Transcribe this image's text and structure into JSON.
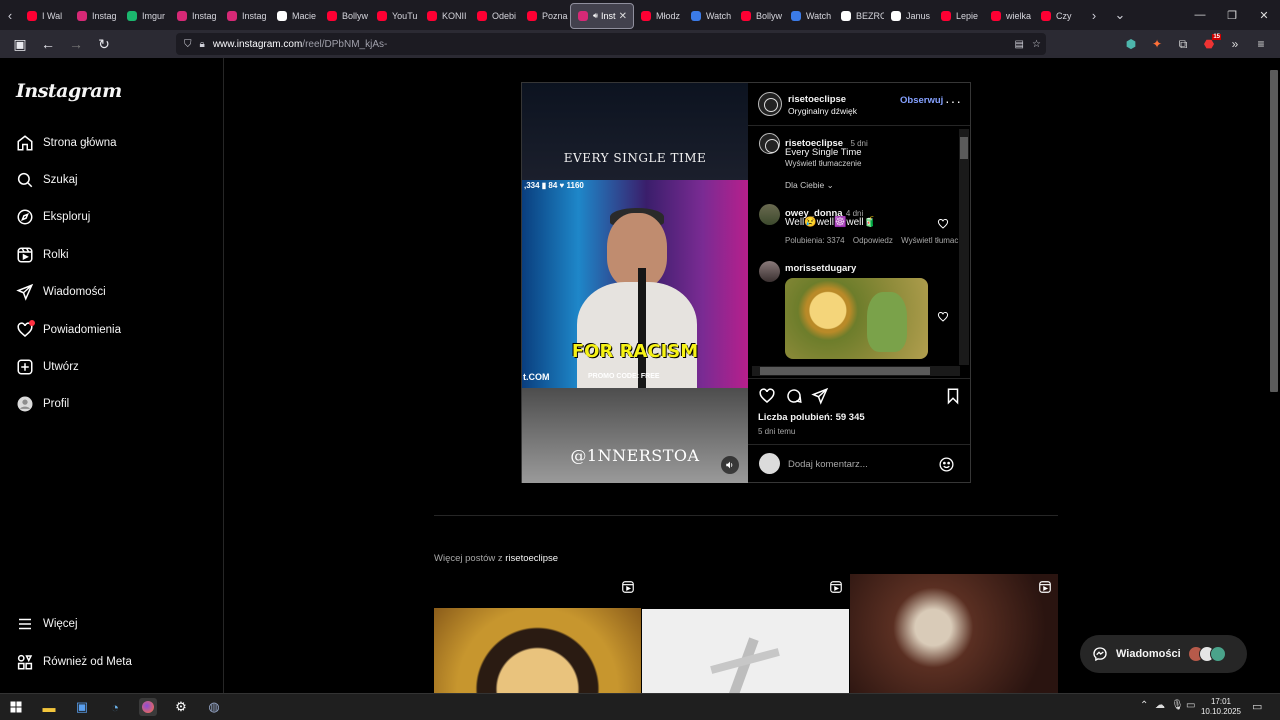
{
  "browser": {
    "tabs": [
      {
        "label": "I Wal",
        "color": "#ff0033"
      },
      {
        "label": "Instag",
        "color": "#d62976"
      },
      {
        "label": "Imgur",
        "color": "#1bb76e"
      },
      {
        "label": "Instag",
        "color": "#d62976"
      },
      {
        "label": "Instag",
        "color": "#d62976"
      },
      {
        "label": "Macie",
        "color": "#ffffff"
      },
      {
        "label": "Bollyw",
        "color": "#ff0033"
      },
      {
        "label": "YouTu",
        "color": "#ff0033"
      },
      {
        "label": "KONII",
        "color": "#ff0033"
      },
      {
        "label": "Odebi",
        "color": "#ff0033"
      },
      {
        "label": "Pozna",
        "color": "#ff0033"
      },
      {
        "label": "Inst",
        "color": "#d62976",
        "active": true
      },
      {
        "label": "Młodz",
        "color": "#ff0033"
      },
      {
        "label": "Watch",
        "color": "#3b7be8"
      },
      {
        "label": "Bollyw",
        "color": "#ff0033"
      },
      {
        "label": "Watch",
        "color": "#3b7be8"
      },
      {
        "label": "BEZRO",
        "color": "#ffffff"
      },
      {
        "label": "Janus",
        "color": "#ffffff"
      },
      {
        "label": "Lepie",
        "color": "#ff0033"
      },
      {
        "label": "wielka",
        "color": "#ff0033"
      },
      {
        "label": "Czy",
        "color": "#ff0033"
      }
    ],
    "url_host": "www.instagram.com",
    "url_path": "/reel/DPbNM_kjAs-",
    "extension_badge": "15"
  },
  "sidebar": {
    "logo": "Instagram",
    "items": [
      {
        "label": "Strona główna",
        "icon": "home-icon"
      },
      {
        "label": "Szukaj",
        "icon": "search-icon"
      },
      {
        "label": "Eksploruj",
        "icon": "explore-icon"
      },
      {
        "label": "Rolki",
        "icon": "reels-icon"
      },
      {
        "label": "Wiadomości",
        "icon": "messages-icon"
      },
      {
        "label": "Powiadomienia",
        "icon": "heart-icon"
      },
      {
        "label": "Utwórz",
        "icon": "create-icon"
      },
      {
        "label": "Profil",
        "icon": "profile-avatar-icon"
      }
    ],
    "bottom": [
      {
        "label": "Więcej",
        "icon": "menu-icon"
      },
      {
        "label": "Również od Meta",
        "icon": "meta-icon"
      }
    ]
  },
  "video": {
    "top_text": "EVERY SINGLE TIME",
    "stats": ",334 ▮ 84 ♥ 1160",
    "caption": "FOR RACISM",
    "promo": "PROMO CODE: FREE",
    "site": "t.COM",
    "handle": "@1NNERSTOA"
  },
  "post": {
    "author": "risetoeclipse",
    "audio": "Oryginalny dźwięk",
    "follow": "Obserwuj",
    "caption_author": "risetoeclipse",
    "caption_age": "5 dni",
    "caption_text": "Every Single Time",
    "translate": "Wyświetl tłumaczenie",
    "for_you": "Dla Ciebie",
    "comments": [
      {
        "user": "owey_donna",
        "age": "4 dni",
        "text": "Well😢well☸️well🧃",
        "likes": "Polubienia: 3374",
        "reply": "Odpowiedz",
        "translate": "Wyświetl tłumac"
      },
      {
        "user": "morissetdugary",
        "age": "",
        "text": ""
      }
    ],
    "likes": "Liczba polubień: 59 345",
    "posted": "5 dni temu",
    "add_comment": "Dodaj komentarz..."
  },
  "more_posts": {
    "prefix": "Więcej postów z ",
    "user": "risetoeclipse"
  },
  "messages_pill": {
    "label": "Wiadomości"
  },
  "taskbar": {
    "time": "17:01",
    "date": "10.10.2025"
  }
}
